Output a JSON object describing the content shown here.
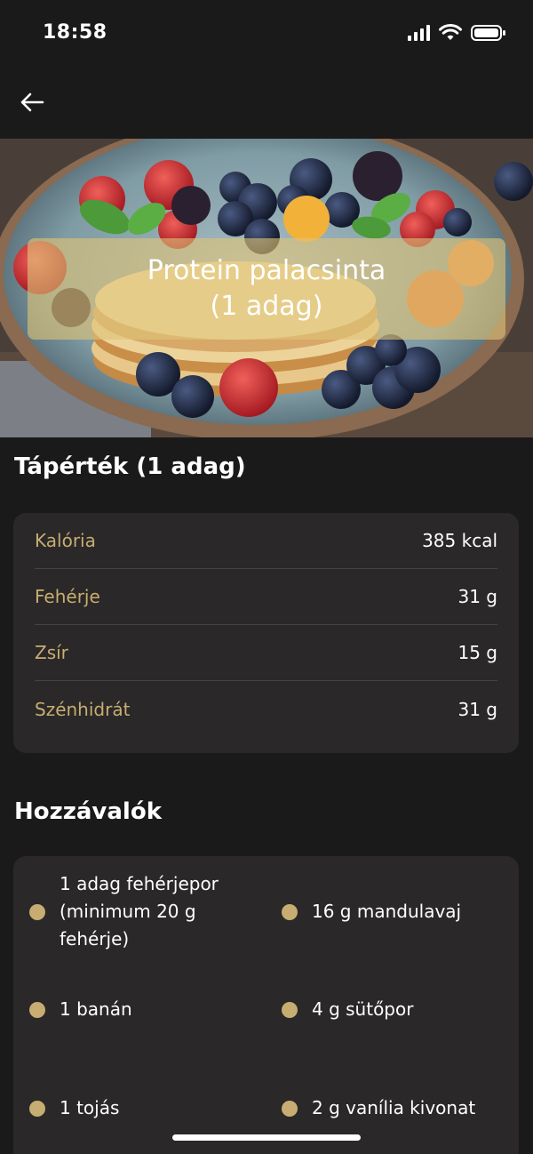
{
  "status_bar": {
    "time": "18:58"
  },
  "header": {
    "back_icon": "arrow-left-icon"
  },
  "hero": {
    "title_line1": "Protein palacsinta",
    "title_line2": "(1 adag)"
  },
  "nutrition": {
    "heading": "Tápérték (1 adag)",
    "rows": [
      {
        "label": "Kalória",
        "value": "385 kcal"
      },
      {
        "label": "Fehérje",
        "value": "31 g"
      },
      {
        "label": "Zsír",
        "value": "15 g"
      },
      {
        "label": "Szénhidrát",
        "value": "31 g"
      }
    ]
  },
  "ingredients": {
    "heading": "Hozzávalók",
    "items": [
      {
        "line1": "1 adag fehérjepor",
        "line2": "(minimum 20 g",
        "line3": "fehérje)"
      },
      {
        "text": "16 g mandulavaj"
      },
      {
        "text": "1 banán"
      },
      {
        "text": "4 g sütőpor"
      },
      {
        "text": "1 tojás"
      },
      {
        "text": "2 g vanília kivonat"
      }
    ]
  },
  "colors": {
    "background": "#1b1a1a",
    "card": "#2a2828",
    "accent": "#c7ad72"
  }
}
